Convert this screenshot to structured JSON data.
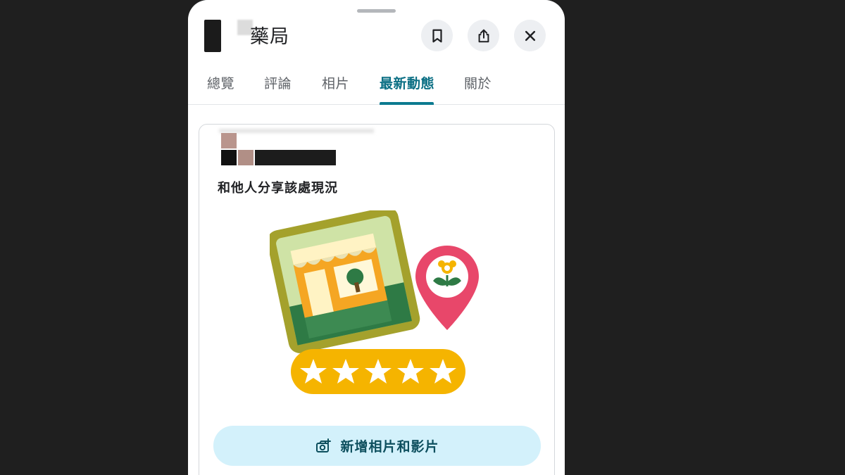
{
  "header": {
    "title": "藥局"
  },
  "actions": {
    "save_icon": "bookmark-icon",
    "share_icon": "share-icon",
    "close_icon": "close-icon"
  },
  "tabs": [
    {
      "label": "總覽",
      "active": false
    },
    {
      "label": "評論",
      "active": false
    },
    {
      "label": "相片",
      "active": false
    },
    {
      "label": "最新動態",
      "active": true
    },
    {
      "label": "關於",
      "active": false
    }
  ],
  "card": {
    "heading": "和他人分享該處現況",
    "illustration": "storefront-with-rating-illustration",
    "rating_stars": 5,
    "button_label": "新增相片和影片",
    "button_icon": "add-photo-camera-icon"
  },
  "colors": {
    "accent": "#0b7a90",
    "button_bg": "#d3f1fb",
    "star_bar": "#f5b400",
    "pin": "#e8476a"
  }
}
